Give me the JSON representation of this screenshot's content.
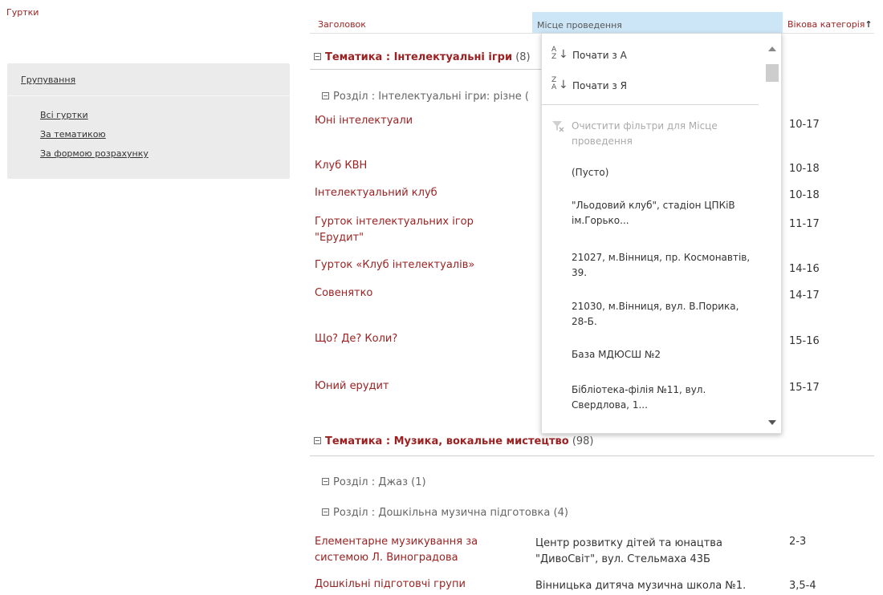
{
  "page_title": "Гуртки",
  "sidebar": {
    "heading": "Групування",
    "links": [
      "Всі гуртки",
      "За тематикою",
      "За формою розрахунку"
    ]
  },
  "columns": {
    "title": "Заголовок",
    "location": "Місце проведення",
    "age": "Вікова категорія",
    "age_sort_indicator": "↑"
  },
  "groups": [
    {
      "label": "Тематика",
      "value": "Інтелектуальні ігри",
      "count": "(8)"
    },
    {
      "label": "Тематика",
      "value": "Музика, вокальне мистецтво",
      "count": "(98)"
    }
  ],
  "subgroups": [
    {
      "label": "Розділ",
      "value": "Інтелектуальні ігри: різне (",
      "count": ""
    },
    {
      "label": "Розділ",
      "value": "Джаз",
      "count": "(1)"
    },
    {
      "label": "Розділ",
      "value": "Дошкільна музична підготовка",
      "count": "(4)"
    }
  ],
  "rows_visible_behind": [
    {
      "title": "Юні інтелектуали",
      "age": "10-17"
    },
    {
      "title": "Клуб КВН",
      "age": "10-18"
    },
    {
      "title": "Інтелектуальний клуб",
      "age": "10-18"
    },
    {
      "title": "Гурток інтелектуальних ігор \"Ерудит\"",
      "age": "11-17"
    },
    {
      "title": "Гурток «Клуб інтелектуалів»",
      "age": "14-16"
    },
    {
      "title": "Совенятко",
      "age": "14-17"
    },
    {
      "title": "Що? Де? Коли?",
      "age": "15-16"
    },
    {
      "title": "Юний ерудит",
      "age": "15-17"
    }
  ],
  "rows_full": [
    {
      "title": "Елементарне музикування за системою Л. Виноградова",
      "location": "Центр розвитку дітей та юнацтва \"ДивоСвіт\", вул. Стельмаха 43Б",
      "age": "2-3"
    },
    {
      "title": "Дошкільні підготовчі групи",
      "location": "Вінницька дитяча музична школа №1.",
      "age": "3,5-4"
    }
  ],
  "dropdown": {
    "sort_asc": "Почати з А",
    "sort_desc": "Почати з Я",
    "clear_filter": "Очистити фільтри для Місце проведення",
    "values": [
      "(Пусто)",
      "\"Льодовий клуб\", стадіон ЦПКіВ ім.Горько...",
      "21027, м.Вінниця, пр. Космонавтів, 39.",
      "21030, м.Вінниця, вул. В.Порика, 28-Б.",
      "База МДЮСШ №2",
      "Бібліотека-філія №11, вул. Свердлова, 1..."
    ]
  },
  "colors": {
    "accent": "#9b2222",
    "header_highlight": "#cde6f7",
    "sidebar_bg": "#ebebeb"
  }
}
